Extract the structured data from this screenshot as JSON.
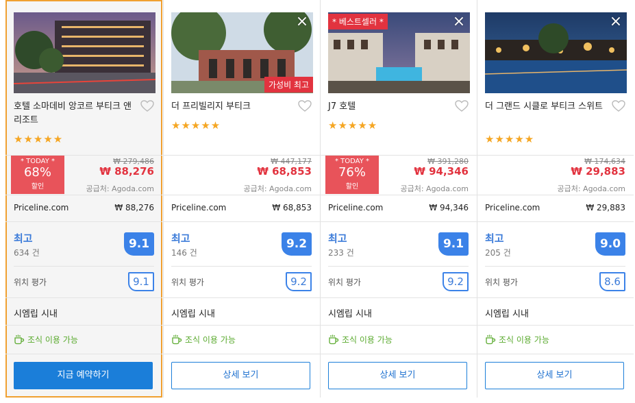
{
  "cards": [
    {
      "name": "호텔 소마데비 앙코르 부티크 앤 리조트",
      "stars": "★★★★★",
      "today_label": "* TODAY *",
      "discount": "68%",
      "discount_suffix": "할인",
      "old_price": "₩ 279,486",
      "price": "₩ 88,276",
      "supplier": "공급처: Agoda.com",
      "vendor": "Priceline.com",
      "vendor_price": "₩  88,276",
      "rating_word": "최고",
      "reviews": "634 건",
      "score": "9.1",
      "location_label": "위치 평가",
      "location_score": "9.1",
      "city": "시엠립 시내",
      "amenity": "조식 이용 가능",
      "button": "지금 예약하기"
    },
    {
      "name": "더 프리빌리지 부티크",
      "stars": "★★★★★",
      "ribbon": "가성비 최고",
      "old_price": "₩ 447,177",
      "price": "₩ 68,853",
      "supplier": "공급처: Agoda.com",
      "vendor": "Priceline.com",
      "vendor_price": "₩  68,853",
      "rating_word": "최고",
      "reviews": "146 건",
      "score": "9.2",
      "location_label": "위치 평가",
      "location_score": "9.2",
      "city": "시엠립 시내",
      "amenity": "조식 이용 가능",
      "button": "상세 보기"
    },
    {
      "name": "J7 호텔",
      "stars": "★★★★★",
      "ribbon": "* 베스트셀러 *",
      "today_label": "* TODAY *",
      "discount": "76%",
      "discount_suffix": "할인",
      "old_price": "₩ 391,280",
      "price": "₩ 94,346",
      "supplier": "공급처: Agoda.com",
      "vendor": "Priceline.com",
      "vendor_price": "₩  94,346",
      "rating_word": "최고",
      "reviews": "233 건",
      "score": "9.1",
      "location_label": "위치 평가",
      "location_score": "9.2",
      "city": "시엠립 시내",
      "amenity": "조식 이용 가능",
      "button": "상세 보기"
    },
    {
      "name": "더 그랜드 시클로 부티크 스위트",
      "stars": "★★★★★",
      "old_price": "₩ 174,634",
      "price": "₩ 29,883",
      "supplier": "공급처: Agoda.com",
      "vendor": "Priceline.com",
      "vendor_price": "₩  29,883",
      "rating_word": "최고",
      "reviews": "205 건",
      "score": "9.0",
      "location_label": "위치 평가",
      "location_score": "8.6",
      "city": "시엠립 시내",
      "amenity": "조식 이용 가능",
      "button": "상세 보기"
    }
  ],
  "icons": {
    "close": "×",
    "heart": "heart-outline-icon",
    "amenity": "coffee-cup-icon"
  },
  "colors": {
    "accent": "#1b7ed9",
    "sale": "#e2333f",
    "score": "#3b82e8",
    "star": "#f5a623",
    "amenity": "#5aaa2e",
    "selected_outline": "#f0a030"
  }
}
